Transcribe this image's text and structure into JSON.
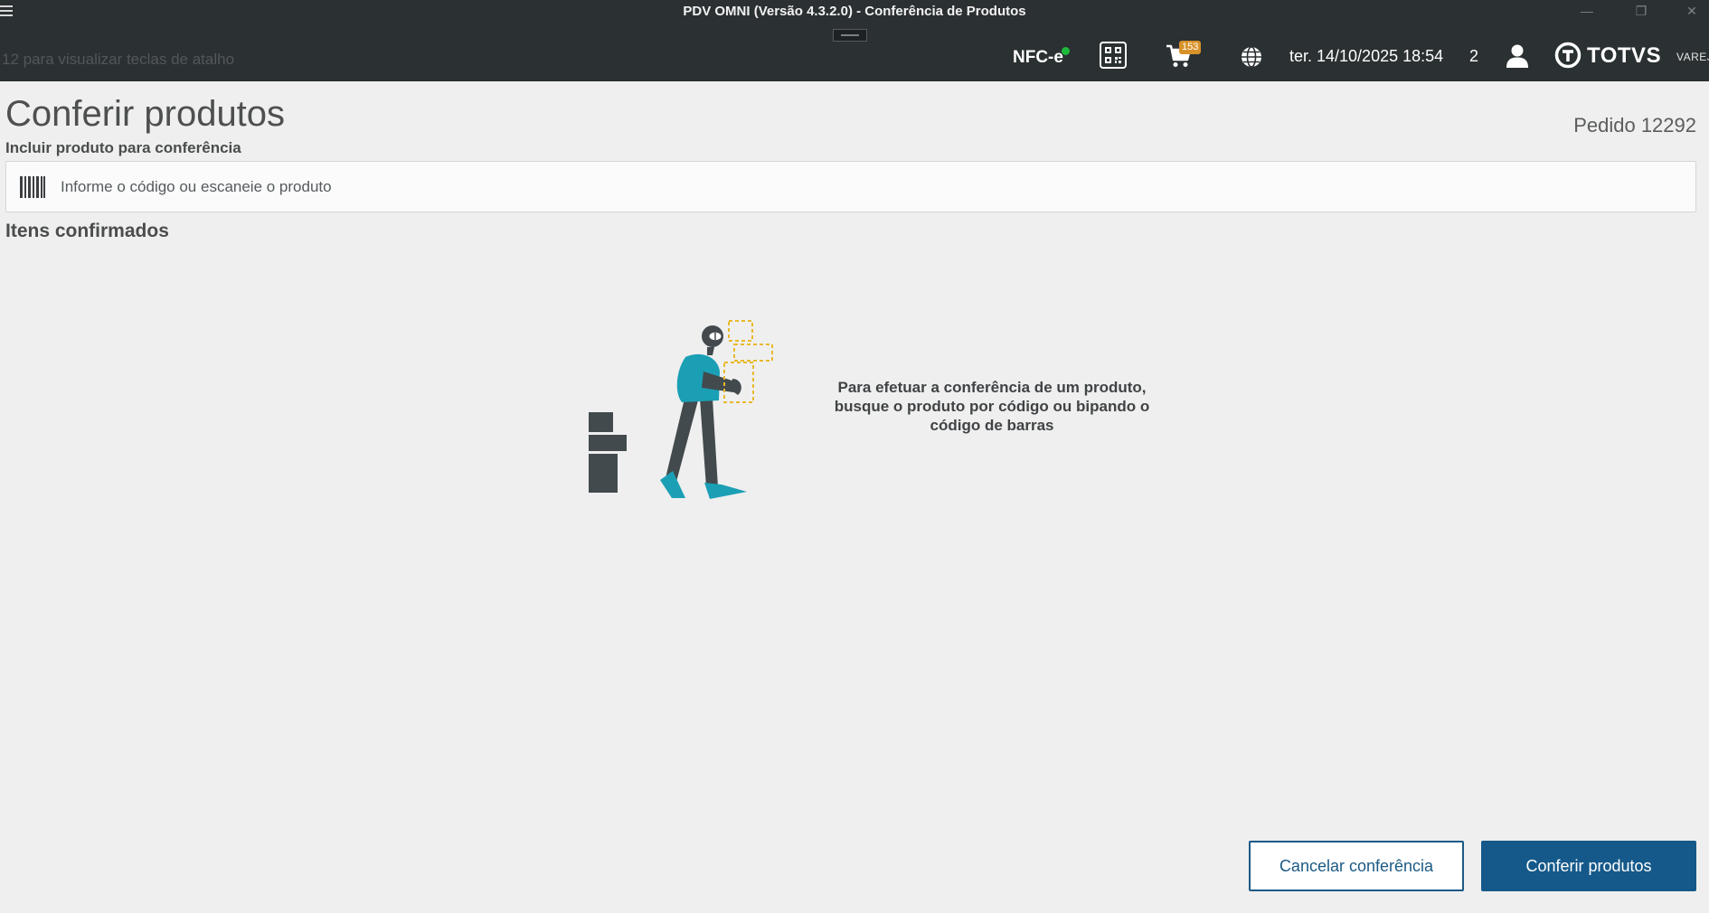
{
  "window": {
    "title": "PDV OMNI (Versão 4.3.2.0) - Conferência de Produtos",
    "minimize_glyph": "—",
    "maximize_glyph": "❐",
    "close_glyph": "✕"
  },
  "header": {
    "shortcut_hint": "12 para visualizar teclas de atalho",
    "nfce_label": "NFC-e",
    "nfce_status_color": "#1eb93a",
    "cart_badge": "153",
    "datetime": "ter. 14/10/2025 18:54",
    "user_count": "2",
    "brand_name": "TOTVS",
    "brand_sub": "VAREJO",
    "icons": [
      "menu-icon",
      "qr-code-icon",
      "cart-icon",
      "globe-icon",
      "user-icon",
      "totvs-logo-icon"
    ]
  },
  "main": {
    "page_title": "Conferir produtos",
    "order_label": "Pedido 12292",
    "include_label": "Incluir produto para conferência",
    "search_placeholder": "Informe o código ou escaneie o produto",
    "confirmed_title": "Itens confirmados",
    "empty_message": "Para efetuar a conferência de um produto, busque o produto por código ou bipando o código de barras"
  },
  "actions": {
    "cancel_label": "Cancelar conferência",
    "confirm_label": "Conferir produtos"
  },
  "colors": {
    "header_bg": "#2b3032",
    "primary": "#15598a",
    "accent_teal": "#1a9fb5",
    "box_yellow": "#e8b92b",
    "badge_orange": "#d8922a"
  }
}
